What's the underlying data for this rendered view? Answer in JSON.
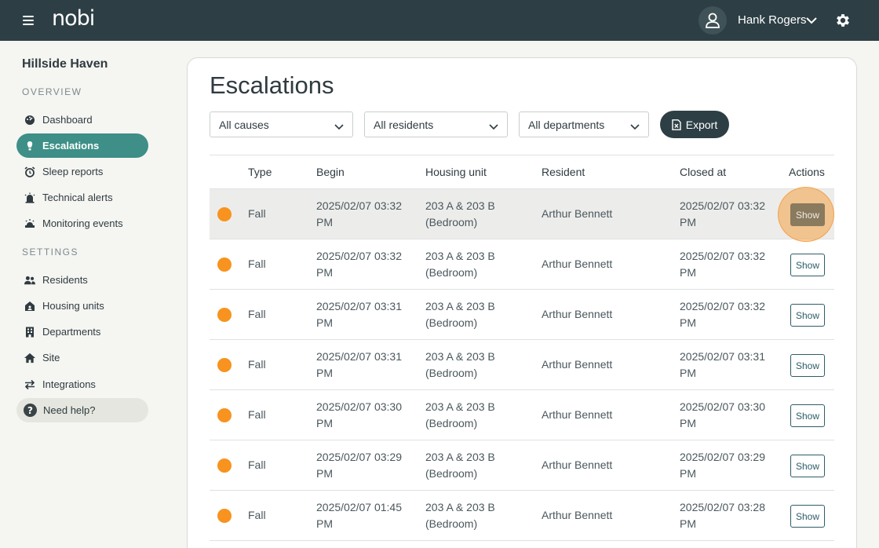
{
  "header": {
    "logo": "nobi",
    "user_name": "Hank Rogers"
  },
  "sidebar": {
    "site_name": "Hillside Haven",
    "overview_label": "OVERVIEW",
    "settings_label": "SETTINGS",
    "overview_items": [
      {
        "label": "Dashboard",
        "icon": "dashboard-icon"
      },
      {
        "label": "Escalations",
        "icon": "escalations-icon",
        "active": true
      },
      {
        "label": "Sleep reports",
        "icon": "alarm-clock-icon"
      },
      {
        "label": "Technical alerts",
        "icon": "alert-icon"
      },
      {
        "label": "Monitoring events",
        "icon": "monitoring-icon"
      }
    ],
    "settings_items": [
      {
        "label": "Residents",
        "icon": "residents-icon"
      },
      {
        "label": "Housing units",
        "icon": "housing-icon"
      },
      {
        "label": "Departments",
        "icon": "building-icon"
      },
      {
        "label": "Site",
        "icon": "home-icon"
      },
      {
        "label": "Integrations",
        "icon": "swap-icon"
      }
    ],
    "help_label": "Need help?"
  },
  "main": {
    "title": "Escalations",
    "filters": {
      "causes": "All causes",
      "residents": "All residents",
      "departments": "All departments"
    },
    "export_label": "Export",
    "columns": [
      "Type",
      "Begin",
      "Housing unit",
      "Resident",
      "Closed at",
      "Actions"
    ],
    "rows": [
      {
        "type": "Fall",
        "begin_1": "2025/02/07 03:32",
        "begin_2": "PM",
        "unit_1": "203 A & 203 B",
        "unit_2": "(Bedroom)",
        "resident": "Arthur Bennett",
        "closed_1": "2025/02/07 03:32",
        "closed_2": "PM",
        "action": "Show"
      },
      {
        "type": "Fall",
        "begin_1": "2025/02/07 03:32",
        "begin_2": "PM",
        "unit_1": "203 A & 203 B",
        "unit_2": "(Bedroom)",
        "resident": "Arthur Bennett",
        "closed_1": "2025/02/07 03:32",
        "closed_2": "PM",
        "action": "Show"
      },
      {
        "type": "Fall",
        "begin_1": "2025/02/07 03:31",
        "begin_2": "PM",
        "unit_1": "203 A & 203 B",
        "unit_2": "(Bedroom)",
        "resident": "Arthur Bennett",
        "closed_1": "2025/02/07 03:32",
        "closed_2": "PM",
        "action": "Show"
      },
      {
        "type": "Fall",
        "begin_1": "2025/02/07 03:31",
        "begin_2": "PM",
        "unit_1": "203 A & 203 B",
        "unit_2": "(Bedroom)",
        "resident": "Arthur Bennett",
        "closed_1": "2025/02/07 03:31",
        "closed_2": "PM",
        "action": "Show"
      },
      {
        "type": "Fall",
        "begin_1": "2025/02/07 03:30",
        "begin_2": "PM",
        "unit_1": "203 A & 203 B",
        "unit_2": "(Bedroom)",
        "resident": "Arthur Bennett",
        "closed_1": "2025/02/07 03:30",
        "closed_2": "PM",
        "action": "Show"
      },
      {
        "type": "Fall",
        "begin_1": "2025/02/07 03:29",
        "begin_2": "PM",
        "unit_1": "203 A & 203 B",
        "unit_2": "(Bedroom)",
        "resident": "Arthur Bennett",
        "closed_1": "2025/02/07 03:29",
        "closed_2": "PM",
        "action": "Show"
      },
      {
        "type": "Fall",
        "begin_1": "2025/02/07 01:45",
        "begin_2": "PM",
        "unit_1": "203 A & 203 B",
        "unit_2": "(Bedroom)",
        "resident": "Arthur Bennett",
        "closed_1": "2025/02/07 03:28",
        "closed_2": "PM",
        "action": "Show"
      }
    ]
  },
  "colors": {
    "header_bg": "#2d3f45",
    "accent": "#3d8f87",
    "status_dot": "#f7931e"
  }
}
